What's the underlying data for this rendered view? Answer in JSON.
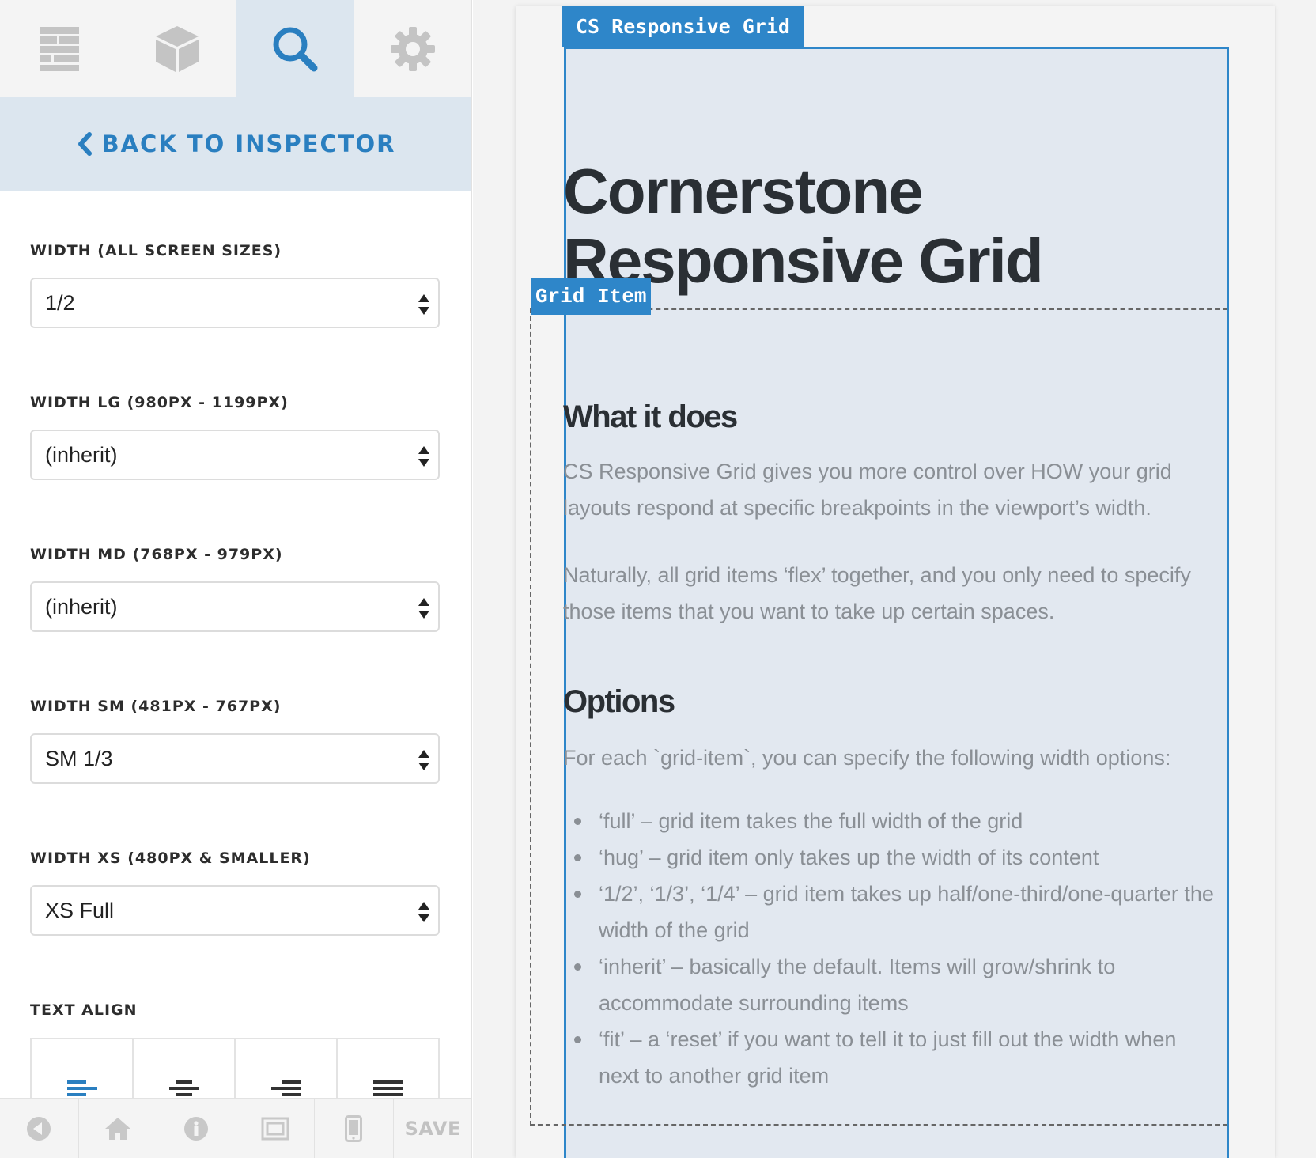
{
  "sidebar": {
    "tabs": [
      {
        "icon": "layout-icon",
        "active": false
      },
      {
        "icon": "cube-icon",
        "active": false
      },
      {
        "icon": "search-icon",
        "active": true
      },
      {
        "icon": "gear-icon",
        "active": false
      }
    ],
    "back_label": "BACK TO INSPECTOR",
    "fields": [
      {
        "label": "WIDTH (ALL SCREEN SIZES)",
        "value": "1/2"
      },
      {
        "label": "WIDTH LG (980PX - 1199PX)",
        "value": "(inherit)"
      },
      {
        "label": "WIDTH MD (768PX - 979PX)",
        "value": "(inherit)"
      },
      {
        "label": "WIDTH SM (481PX - 767PX)",
        "value": "SM 1/3"
      },
      {
        "label": "WIDTH XS (480PX & SMALLER)",
        "value": "XS Full"
      }
    ],
    "text_align_label": "TEXT ALIGN",
    "align_options": [
      "align-left-icon",
      "align-center-icon",
      "align-right-icon",
      "align-justify-icon"
    ],
    "bottom_bar": {
      "icons": [
        "back-circle-icon",
        "home-icon",
        "info-icon",
        "fullscreen-icon",
        "mobile-icon"
      ],
      "save_label": "SAVE"
    }
  },
  "preview": {
    "grid_tag": "CS Responsive Grid",
    "item_tag": "Grid Item",
    "title": "Cornerstone Responsive Grid",
    "section1_heading": "What it does",
    "section1_p1": "CS Responsive Grid gives you more control over HOW your grid layouts respond at specific breakpoints in the viewport’s width.",
    "section1_p2": "Naturally, all grid items ‘flex’ together, and you only need to specify those items that you want to take up certain spaces.",
    "section2_heading": "Options",
    "section2_intro": "For each `grid-item`, you can specify the following width options:",
    "options": [
      "‘full’ – grid item takes the full width of the grid",
      "‘hug’ – grid item only takes up the width of its content",
      "‘1/2’, ‘1/3’, ‘1/4’ – grid item takes up half/one-third/one-quarter the width of the grid",
      "‘inherit’ – basically the default. Items will grow/shrink to accommodate surrounding items",
      "‘fit’ – a ‘reset’ if you want to tell it to just fill out the width when next to another grid item"
    ]
  },
  "colors": {
    "accent": "#2a7fc0",
    "tag_blue": "#2e86c9",
    "grid_bg": "#e2e8f0",
    "tab_active_bg": "#dce6ef"
  }
}
